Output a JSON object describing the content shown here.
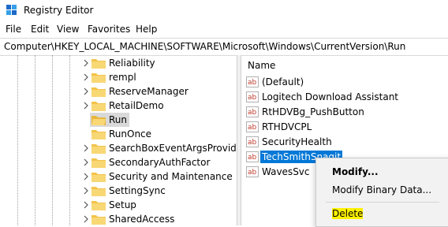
{
  "window": {
    "title": "Registry Editor"
  },
  "menu": [
    "File",
    "Edit",
    "View",
    "Favorites",
    "Help"
  ],
  "address": "Computer\\HKEY_LOCAL_MACHINE\\SOFTWARE\\Microsoft\\Windows\\CurrentVersion\\Run",
  "tree": {
    "items": [
      {
        "label": "Reliability"
      },
      {
        "label": "rempl"
      },
      {
        "label": "ReserveManager"
      },
      {
        "label": "RetailDemo"
      },
      {
        "label": "Run",
        "selected": true
      },
      {
        "label": "RunOnce"
      },
      {
        "label": "SearchBoxEventArgsProvide"
      },
      {
        "label": "SecondaryAuthFactor"
      },
      {
        "label": "Security and Maintenance"
      },
      {
        "label": "SettingSync"
      },
      {
        "label": "Setup"
      },
      {
        "label": "SharedAccess"
      }
    ]
  },
  "values_pane": {
    "column_name": "Name",
    "items": [
      {
        "name": "(Default)"
      },
      {
        "name": "Logitech Download Assistant"
      },
      {
        "name": "RtHDVBg_PushButton"
      },
      {
        "name": "RTHDVCPL"
      },
      {
        "name": "SecurityHealth"
      },
      {
        "name": "TechSmithSnagit",
        "selected": true
      },
      {
        "name": "WavesSvc"
      }
    ]
  },
  "context_menu": {
    "modify": "Modify...",
    "modify_binary": "Modify Binary Data...",
    "delete": "Delete"
  },
  "colors": {
    "selection": "#0078d7",
    "highlight": "#fff200",
    "folder": "#f3c34a"
  }
}
